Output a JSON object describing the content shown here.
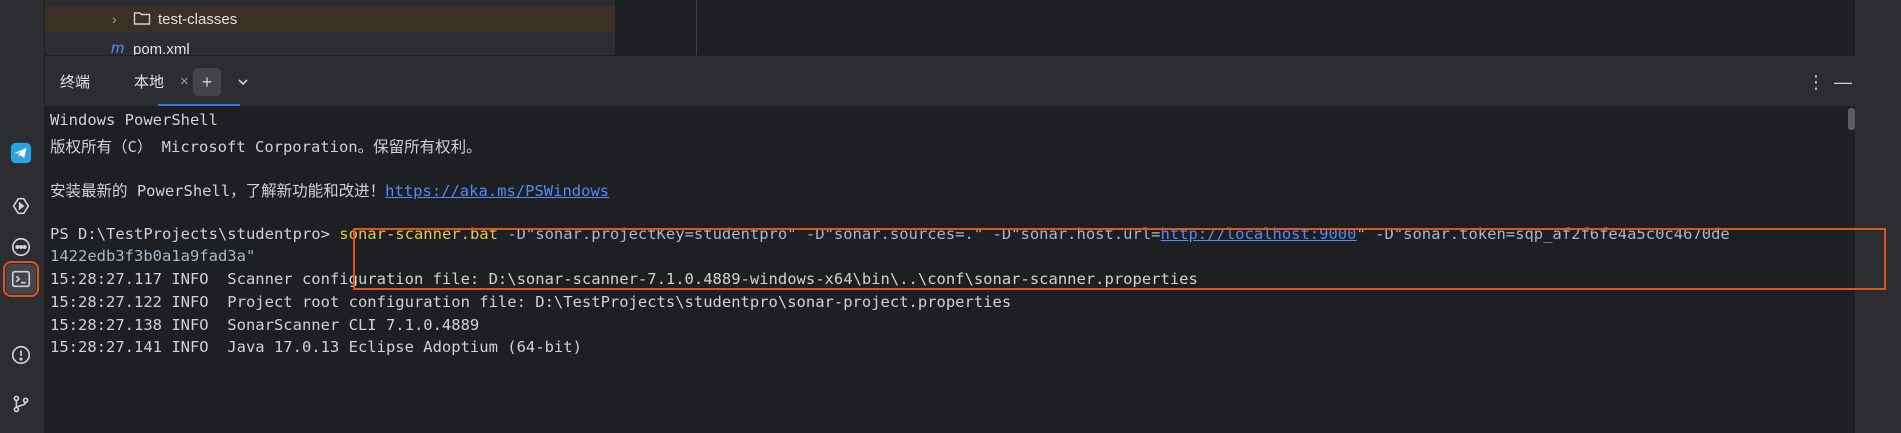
{
  "tree": {
    "items": [
      {
        "label": "test-classes",
        "icon": "folder-icon",
        "expanded": false
      },
      {
        "label": "pom.xml",
        "icon": "maven-file-icon"
      }
    ]
  },
  "sidebar": {
    "icons": [
      "telegram-icon",
      "run-icon",
      "services-icon",
      "terminal-icon",
      "problems-icon",
      "git-icon"
    ],
    "active": "terminal-icon"
  },
  "terminal": {
    "title": "终端",
    "tabs": [
      {
        "label": "本地",
        "active": true
      }
    ],
    "new_tab": "+",
    "dropdown": "⌄",
    "more": "⋮",
    "minimize": "—",
    "lines": {
      "l1": "Windows PowerShell",
      "l2": "版权所有（C） Microsoft Corporation。保留所有权利。",
      "l3_prefix": "安装最新的 PowerShell，了解新功能和改进！",
      "l3_link": "https://aka.ms/PSWindows",
      "prompt": "PS D:\\TestProjects\\studentpro> ",
      "cmd": "sonar-scanner.bat",
      "arg1": " -D\"sonar.projectKey=studentpro\" -D\"sonar.sources=.\" -D\"sonar.host.url=",
      "arg_link": "http://localhost:9000",
      "arg2": "\" -D\"sonar.token=sqp_af2f6fe4a5c0c4670de",
      "arg3": "1422edb3f3b0a1a9fad3a\"",
      "log1": "15:28:27.117 INFO  Scanner configuration file: D:\\sonar-scanner-7.1.0.4889-windows-x64\\bin\\..\\conf\\sonar-scanner.properties",
      "log2": "15:28:27.122 INFO  Project root configuration file: D:\\TestProjects\\studentpro\\sonar-project.properties",
      "log3": "15:28:27.138 INFO  SonarScanner CLI 7.1.0.4889",
      "log4": "15:28:27.141 INFO  Java 17.0.13 Eclipse Adoptium (64-bit)"
    }
  },
  "colors": {
    "accent": "#3574f0",
    "highlight": "#e0531f",
    "command": "#e6c84a",
    "link": "#548af7"
  }
}
